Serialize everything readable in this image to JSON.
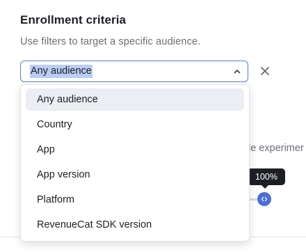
{
  "section": {
    "title": "Enrollment criteria",
    "subtitle": "Use filters to target a specific audience."
  },
  "audience_select": {
    "value": "Any audience",
    "options": [
      {
        "label": "Any audience",
        "highlighted": true
      },
      {
        "label": "Country"
      },
      {
        "label": "App"
      },
      {
        "label": "App version"
      },
      {
        "label": "Platform"
      },
      {
        "label": "RevenueCat SDK version"
      }
    ]
  },
  "background": {
    "partial_text": "le experimer"
  },
  "slider": {
    "tooltip": "100%",
    "value_percent": 100
  },
  "colors": {
    "accent": "#4a6fd8",
    "select_border": "#5a7bd6",
    "selection_highlight": "#b9cdf5",
    "option_hover": "#eceef4",
    "tooltip_bg": "#1d1f24"
  },
  "icons": {
    "select_chevron": "chevron-up-icon",
    "clear": "close-icon",
    "slider_thumb": "code-brackets-icon"
  }
}
